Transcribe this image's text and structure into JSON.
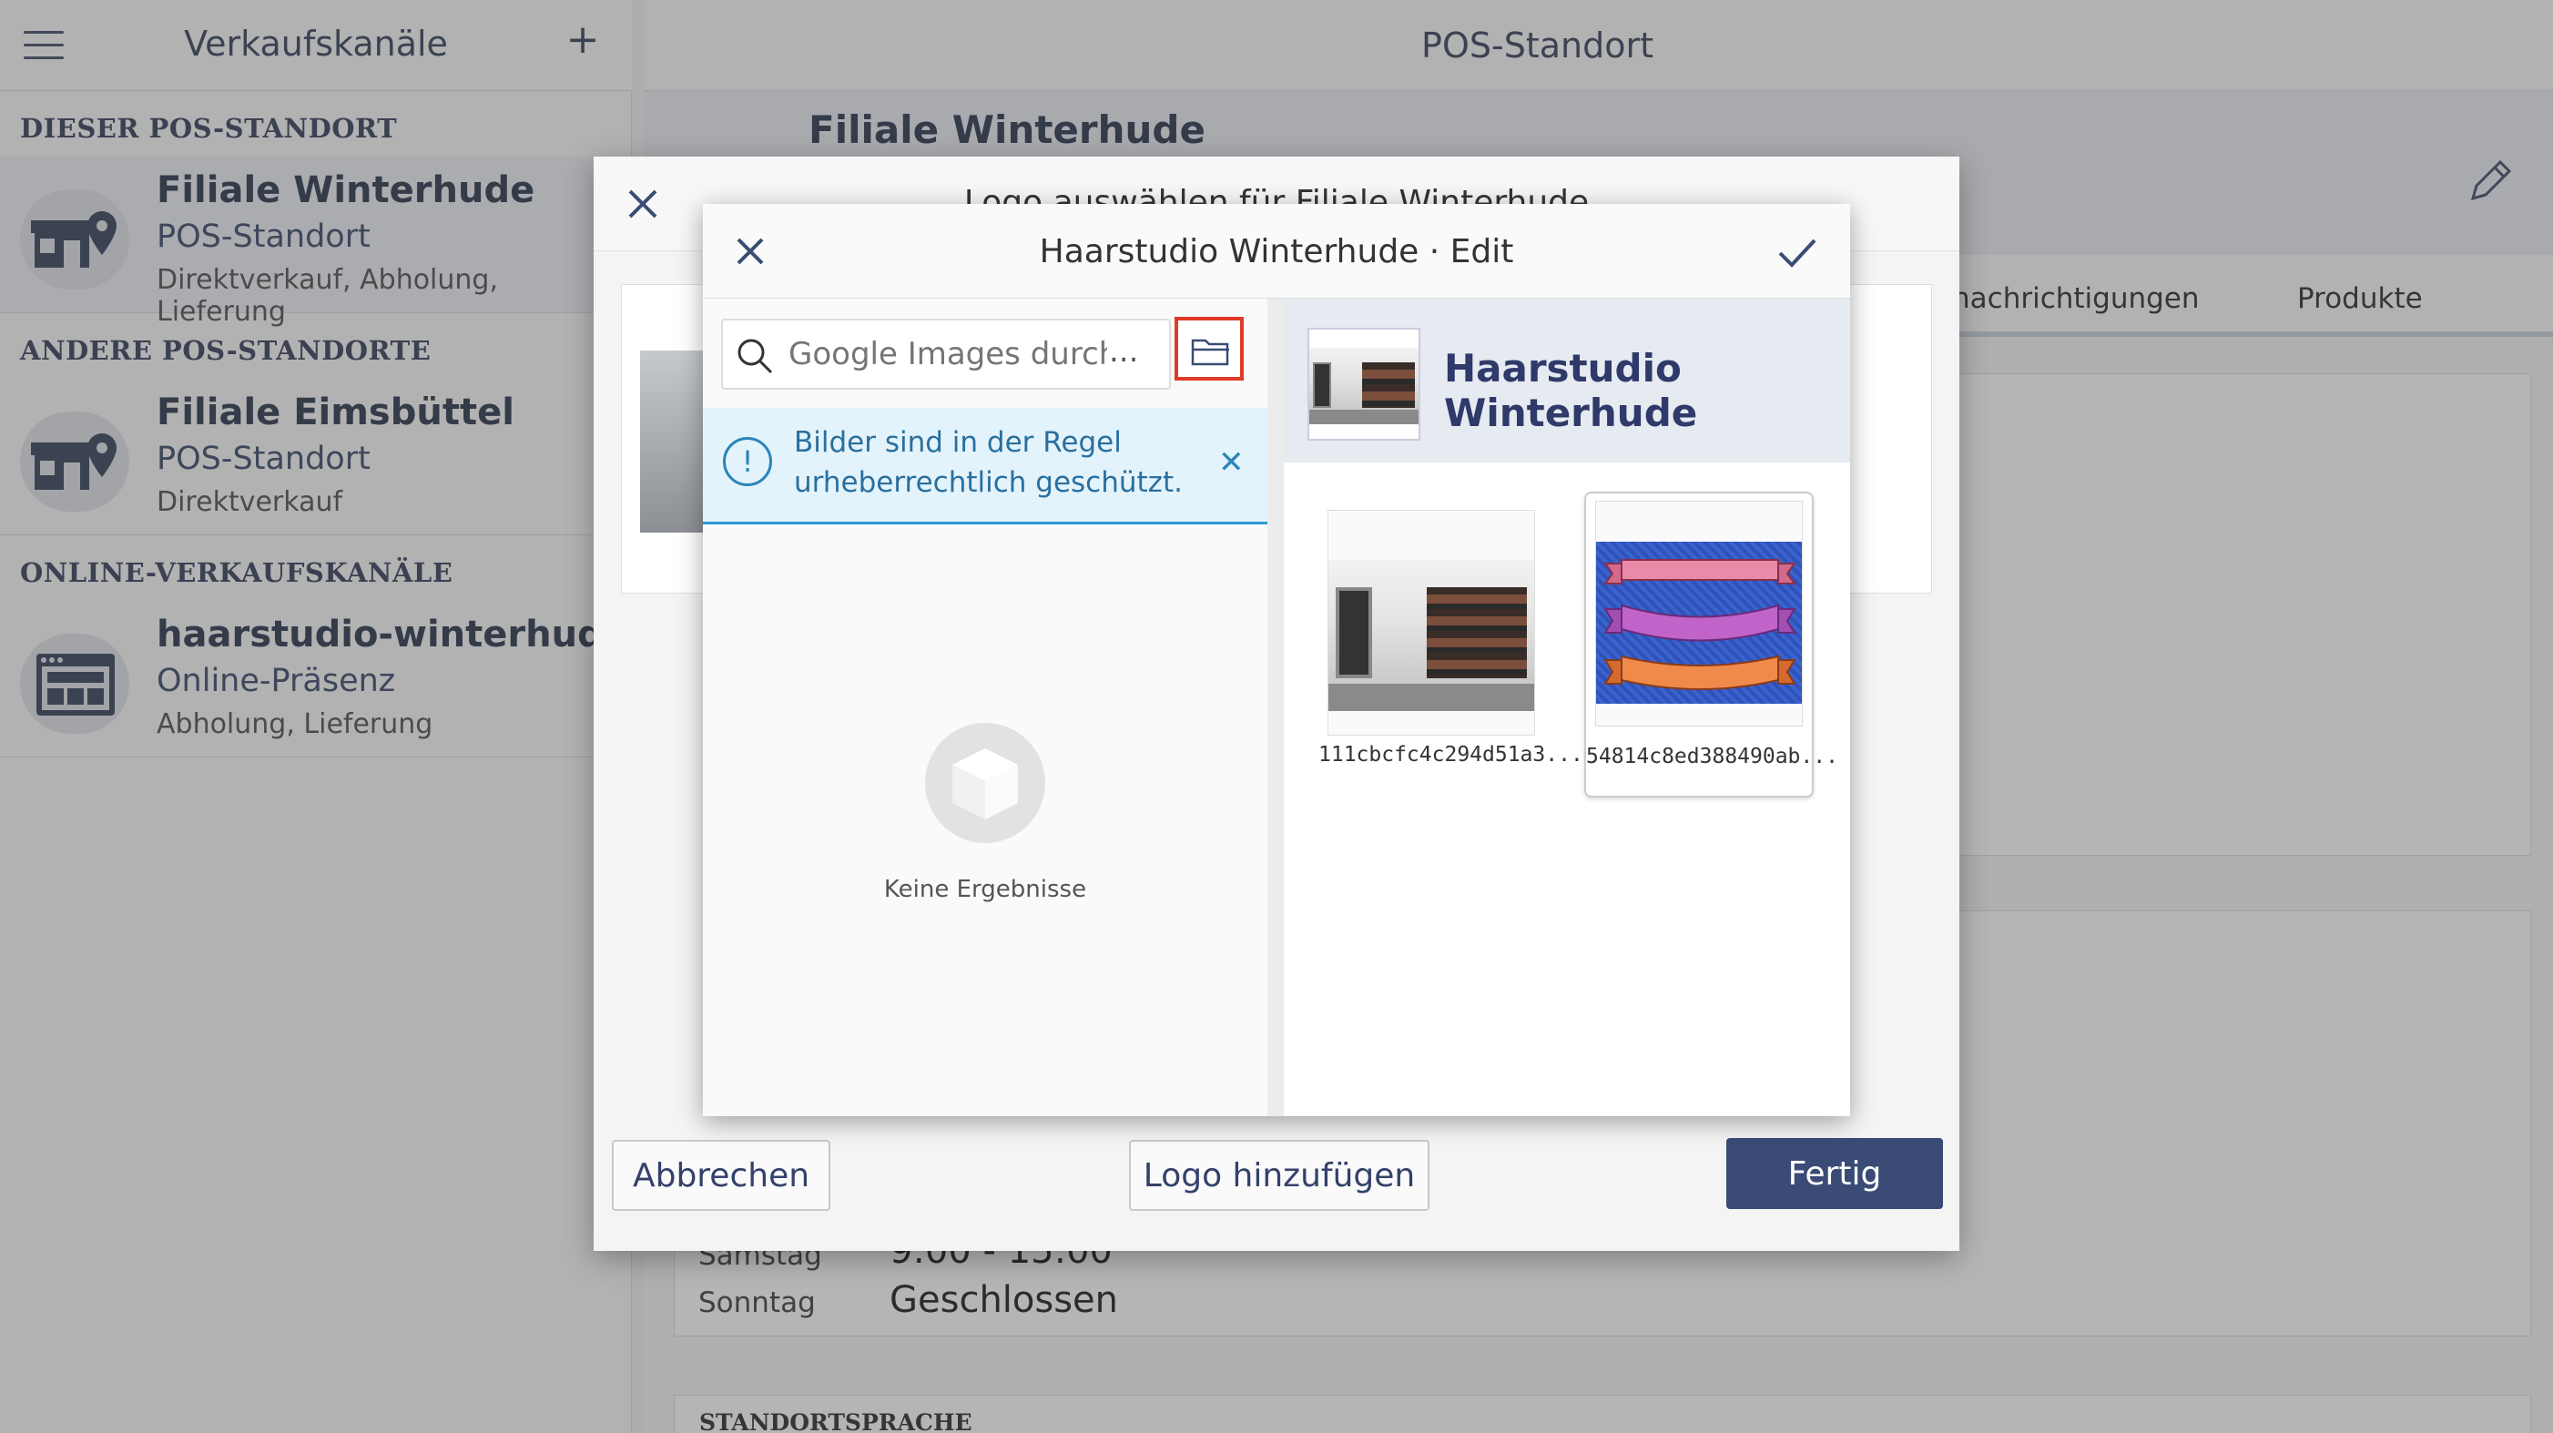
{
  "sidebar": {
    "title": "Verkaufskanäle",
    "sections": {
      "this_pos": "DIESER POS-STANDORT",
      "other_pos": "ANDERE POS-STANDORTE",
      "online": "ONLINE-VERKAUFSKANÄLE"
    },
    "items": [
      {
        "name": "Filiale Winterhude",
        "type": "POS-Standort",
        "sub": "Direktverkauf, Abholung, Lieferung"
      },
      {
        "name": "Filiale Eimsbüttel",
        "type": "POS-Standort",
        "sub": "Direktverkauf"
      },
      {
        "name": "haarstudio-winterhude",
        "type": "Online-Präsenz",
        "sub": "Abholung, Lieferung"
      }
    ]
  },
  "main": {
    "title": "POS-Standort",
    "store_name": "Filiale Winterhude",
    "tabs": [
      "nachrichtigungen",
      "Produkte"
    ],
    "hours": [
      {
        "day": "Samstag",
        "value": "9:00 - 15:00"
      },
      {
        "day": "Sonntag",
        "value": "Geschlossen"
      }
    ],
    "language_label": "STANDORTSPRACHE"
  },
  "outer_dialog": {
    "title": "Logo auswählen für Filiale Winterhude",
    "cancel_label": "Abbrechen",
    "add_logo_label": "Logo hinzufügen",
    "done_label": "Fertig"
  },
  "inner_dialog": {
    "title": "Haarstudio Winterhude · Edit",
    "search": {
      "placeholder": "Google Images durch...",
      "ellipsis": "..."
    },
    "info_message": "Bilder sind in der Regel urheberrechtlich geschützt.",
    "empty_text": "Keine Ergebnisse",
    "album_name": "Haarstudio Winterhude",
    "images": [
      {
        "caption": "111cbcfc4c294d51a3...",
        "selected": false
      },
      {
        "caption": "54814c8ed388490ab...",
        "selected": true
      }
    ]
  },
  "colors": {
    "accent": "#3a4c75",
    "info_blue": "#2b84b8",
    "highlight_red": "#e03a28"
  },
  "icons": [
    "menu-icon",
    "plus-icon",
    "store-location-icon",
    "web-icon",
    "pencil-icon",
    "close-icon",
    "check-icon",
    "search-icon",
    "folder-icon",
    "info-icon",
    "box-icon"
  ]
}
